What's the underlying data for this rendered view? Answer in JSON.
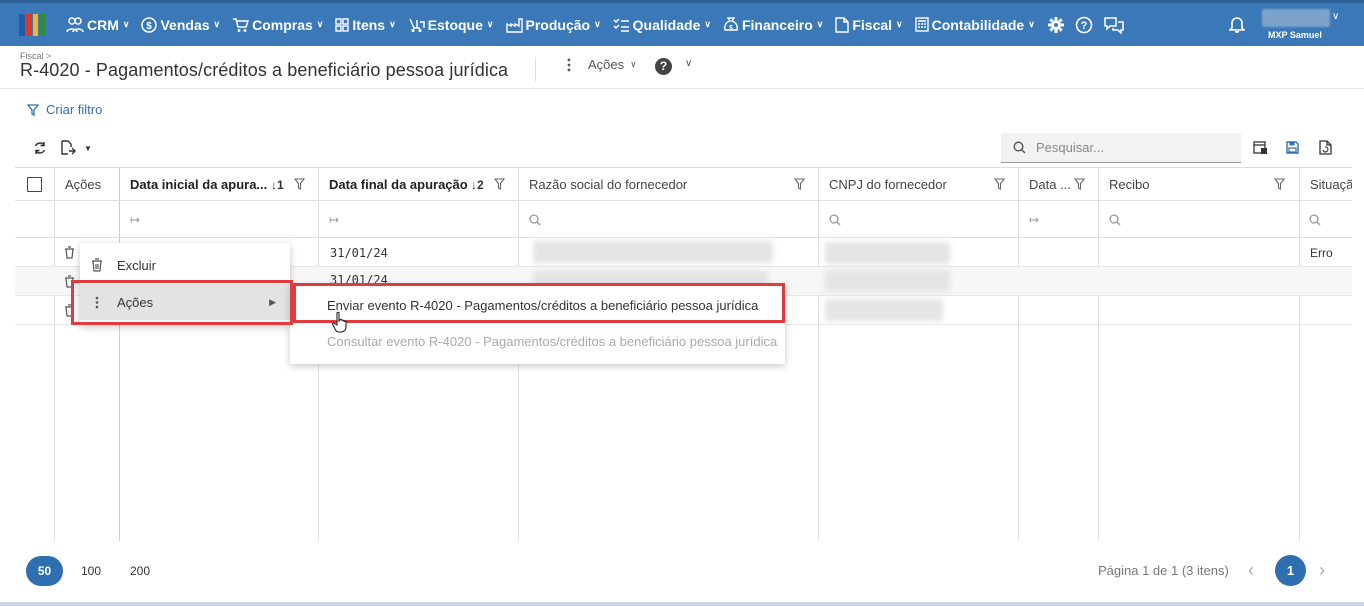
{
  "brand": {
    "logo_colors": [
      "#1c5fa8",
      "#d33a2c",
      "#f1b62b",
      "#2e8b3e"
    ]
  },
  "nav": {
    "items": [
      {
        "label": "CRM",
        "icon": "crm-people-icon"
      },
      {
        "label": "Vendas",
        "icon": "dollar-circle-icon"
      },
      {
        "label": "Compras",
        "icon": "cart-icon"
      },
      {
        "label": "Itens",
        "icon": "grid-items-icon"
      },
      {
        "label": "Estoque",
        "icon": "forklift-icon"
      },
      {
        "label": "Produção",
        "icon": "factory-icon"
      },
      {
        "label": "Qualidade",
        "icon": "checklist-icon"
      },
      {
        "label": "Financeiro",
        "icon": "money-bag-icon"
      },
      {
        "label": "Fiscal",
        "icon": "document-icon"
      },
      {
        "label": "Contabilidade",
        "icon": "calculator-icon"
      }
    ],
    "user_name": "MXP Samuel"
  },
  "header": {
    "breadcrumb": "Fiscal >",
    "title": "R-4020 - Pagamentos/créditos a beneficiário pessoa jurídica",
    "actions_label": "Ações"
  },
  "filter_link": "Criar filtro",
  "search": {
    "placeholder": "Pesquisar..."
  },
  "grid": {
    "columns": [
      {
        "label": "Ações"
      },
      {
        "label": "Data inicial da apura...",
        "sort": "↓1"
      },
      {
        "label": "Data final da apuração",
        "sort": "↓2"
      },
      {
        "label": "Razão social do fornecedor"
      },
      {
        "label": "CNPJ do fornecedor"
      },
      {
        "label": "Data ..."
      },
      {
        "label": "Recibo"
      },
      {
        "label": "Situaçã"
      }
    ],
    "rows": [
      {
        "data_final": "31/01/24",
        "situacao": "Erro"
      },
      {
        "data_final": "31/01/24",
        "situacao": ""
      },
      {
        "data_final": "",
        "situacao": ""
      }
    ]
  },
  "context_menu": {
    "items": [
      {
        "label": "Excluir",
        "icon": "trash-icon"
      },
      {
        "label": "Ações",
        "icon": "vertical-dots-icon"
      }
    ],
    "submenu": [
      {
        "label": "Enviar evento R-4020 - Pagamentos/créditos a beneficiário pessoa jurídica",
        "enabled": true
      },
      {
        "label": "Consultar evento R-4020 - Pagamentos/créditos a beneficiário pessoa jurídica",
        "enabled": false
      }
    ]
  },
  "pagination": {
    "page_sizes": [
      "50",
      "100",
      "200"
    ],
    "active_page_size": "50",
    "info": "Página 1 de 1 (3 itens)",
    "current_page": "1"
  },
  "colors": {
    "nav_bg": "#3a78b8",
    "accent": "#2f6fb0",
    "highlight": "#e23b3b"
  }
}
